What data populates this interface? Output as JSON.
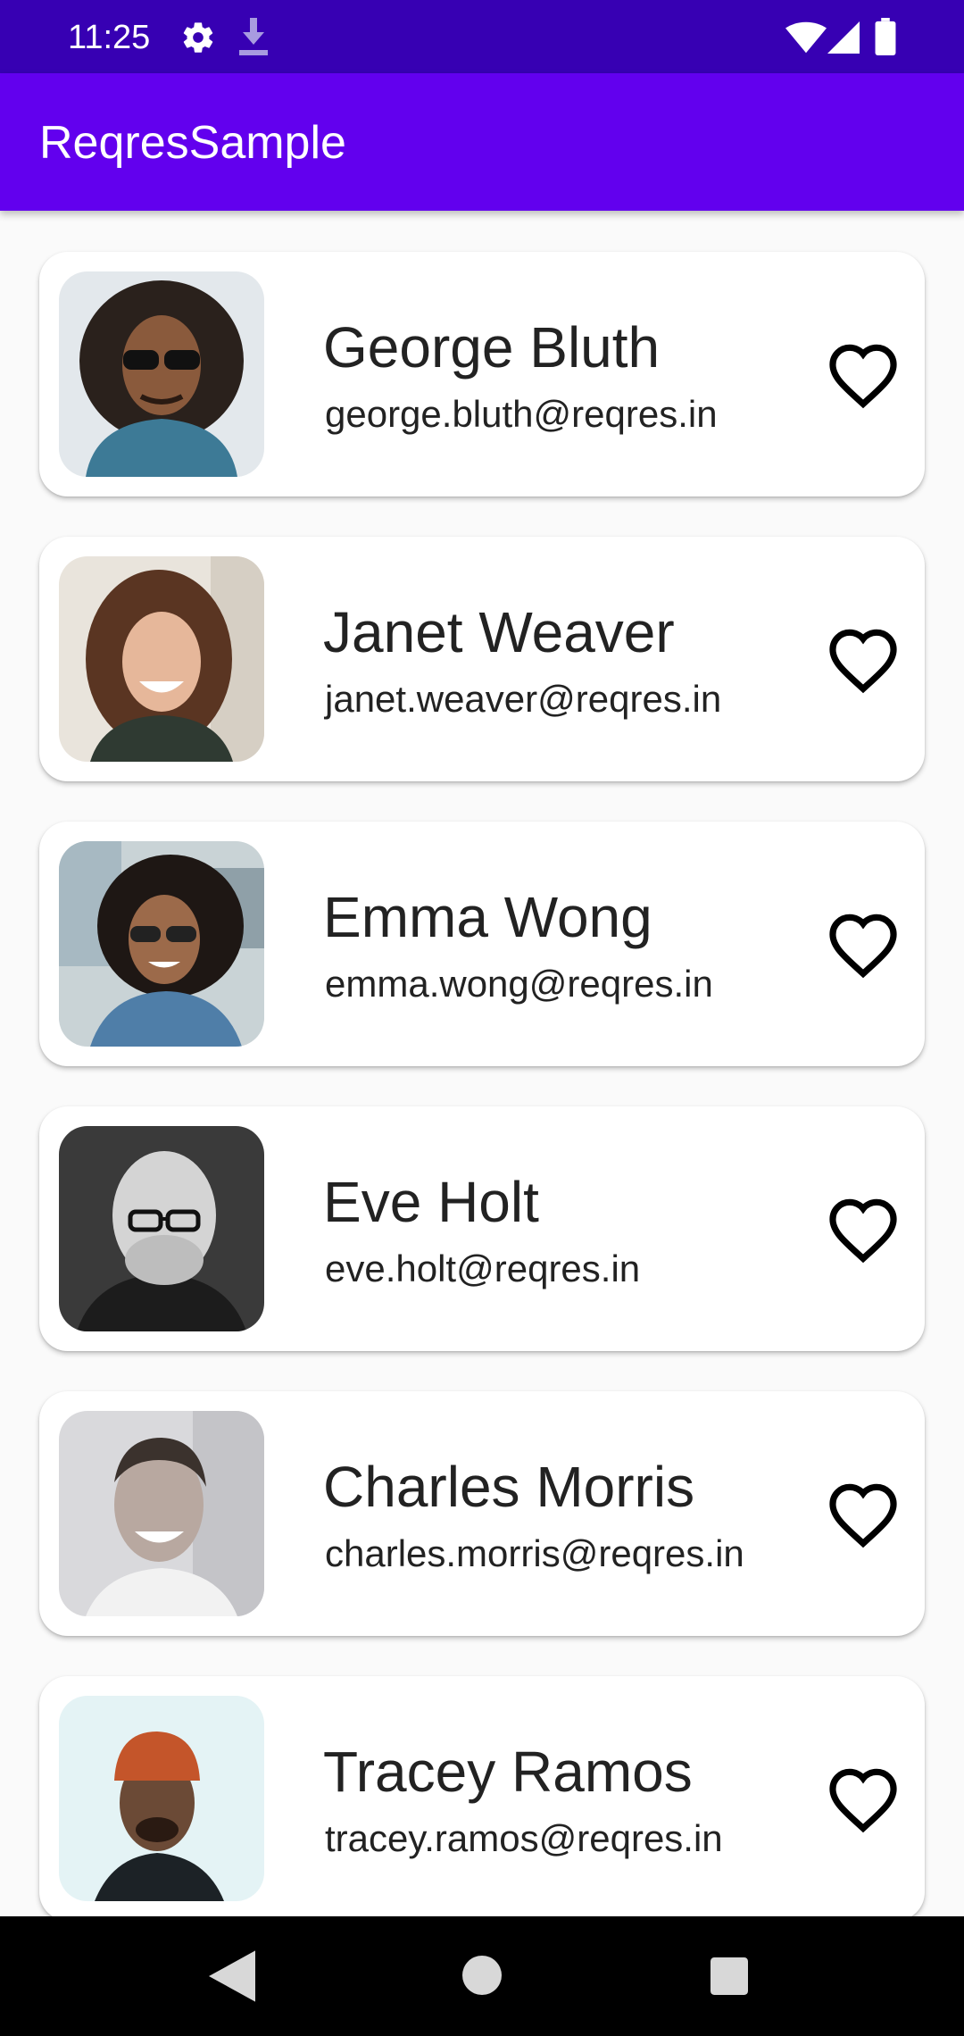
{
  "status_bar": {
    "time": "11:25",
    "icons": [
      "settings-icon",
      "download-icon",
      "wifi-icon",
      "signal-icon",
      "battery-icon"
    ],
    "color": "#3700b3"
  },
  "app_bar": {
    "title": "ReqresSample",
    "color": "#6200ee"
  },
  "users": [
    {
      "name": "George Bluth",
      "email": "george.bluth@reqres.in",
      "favorite": false
    },
    {
      "name": "Janet Weaver",
      "email": "janet.weaver@reqres.in",
      "favorite": false
    },
    {
      "name": "Emma Wong",
      "email": "emma.wong@reqres.in",
      "favorite": false
    },
    {
      "name": "Eve Holt",
      "email": "eve.holt@reqres.in",
      "favorite": false
    },
    {
      "name": "Charles Morris",
      "email": "charles.morris@reqres.in",
      "favorite": false
    },
    {
      "name": "Tracey Ramos",
      "email": "tracey.ramos@reqres.in",
      "favorite": false
    }
  ],
  "nav_bar": {
    "icons": [
      "back-icon",
      "home-icon",
      "recents-icon"
    ]
  }
}
